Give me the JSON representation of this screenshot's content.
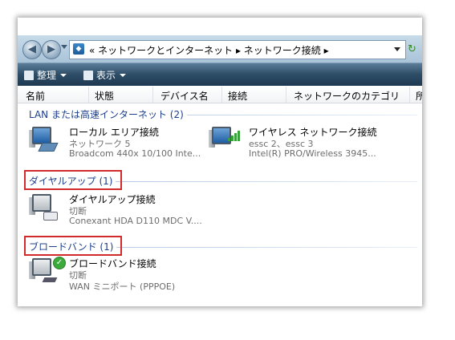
{
  "address_bar": {
    "breadcrumb": "« ネットワークとインターネット ▸ ネットワーク接続 ▸"
  },
  "toolbar": {
    "organize": "整理",
    "views": "表示"
  },
  "columns": [
    "名前",
    "状態",
    "デバイス名",
    "接続",
    "ネットワークのカテゴリ",
    "所"
  ],
  "groups": [
    {
      "label": "LAN または高速インターネット (2)",
      "items": [
        {
          "name": "ローカル エリア接続",
          "status": "ネットワーク 5",
          "device": "Broadcom 440x 10/100 Inte..."
        },
        {
          "name": "ワイヤレス ネットワーク接続",
          "status": "essc 2、essc 3",
          "device": "Intel(R) PRO/Wireless 3945..."
        }
      ]
    },
    {
      "label": "ダイヤルアップ (1)",
      "items": [
        {
          "name": "ダイヤルアップ接続",
          "status": "切断",
          "device": "Conexant HDA D110 MDC V...."
        }
      ]
    },
    {
      "label": "ブロードバンド (1)",
      "items": [
        {
          "name": "ブロードバンド接続",
          "status": "切断",
          "device": "WAN ミニポート (PPPOE)"
        }
      ]
    }
  ],
  "icons": {
    "back": "back-arrow-icon",
    "forward": "forward-arrow-icon",
    "refresh": "refresh-icon"
  },
  "colors": {
    "group_label": "#1e3f8c",
    "highlight_box": "#d12a2a",
    "toolbar": "#2d4c66"
  }
}
